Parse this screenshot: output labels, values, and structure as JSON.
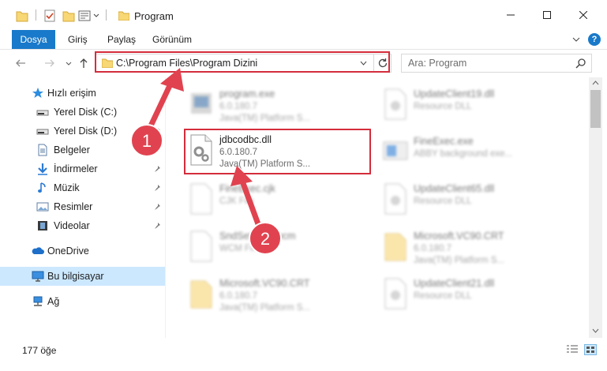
{
  "window": {
    "title": "Program"
  },
  "ribbon": {
    "tabs": [
      "Dosya",
      "Giriş",
      "Paylaş",
      "Görünüm"
    ]
  },
  "address": {
    "path": "C:\\Program Files\\Program Dizini"
  },
  "search": {
    "placeholder": "Ara: Program"
  },
  "sidebar": {
    "items": [
      {
        "label": "Hızlı erişim",
        "icon": "star-icon"
      },
      {
        "label": "Yerel Disk (C:)",
        "icon": "drive-icon",
        "pinned": true
      },
      {
        "label": "Yerel Disk (D:)",
        "icon": "drive-icon",
        "pinned": true
      },
      {
        "label": "Belgeler",
        "icon": "documents-icon",
        "pinned": true
      },
      {
        "label": "İndirmeler",
        "icon": "downloads-icon",
        "pinned": true
      },
      {
        "label": "Müzik",
        "icon": "music-icon",
        "pinned": true
      },
      {
        "label": "Resimler",
        "icon": "pictures-icon",
        "pinned": true
      },
      {
        "label": "Videolar",
        "icon": "videos-icon",
        "pinned": true
      },
      {
        "label": "OneDrive",
        "icon": "cloud-icon"
      },
      {
        "label": "Bu bilgisayar",
        "icon": "computer-icon",
        "selected": true
      },
      {
        "label": "Ağ",
        "icon": "network-icon"
      }
    ]
  },
  "files": [
    {
      "name": "program.exe",
      "line2": "6.0.180.7",
      "line3": "Java(TM) Platform S...",
      "icon": "exe-icon"
    },
    {
      "name": "UpdateClient19.dll",
      "line2": "Resource DLL",
      "line3": "",
      "icon": "dll-icon"
    },
    {
      "name": "jdbcodbc.dll",
      "line2": "6.0.180.7",
      "line3": "Java(TM) Platform S...",
      "icon": "dll-gear-icon",
      "highlighted": true
    },
    {
      "name": "FineExec.exe",
      "line2": "ABBY background exe...",
      "line3": "",
      "icon": "exe-icon"
    },
    {
      "name": "FineExec.cjk",
      "line2": "CJK File",
      "line3": "",
      "icon": "file-icon"
    },
    {
      "name": "UpdateClient65.dll",
      "line2": "Resource DLL",
      "line3": "",
      "icon": "dll-icon"
    },
    {
      "name": "SndSettings.wcm",
      "line2": "WCM File",
      "line3": "",
      "icon": "file-icon"
    },
    {
      "name": "Microsoft.VC90.CRT",
      "line2": "6.0.180.7",
      "line3": "Java(TM) Platform S...",
      "icon": "folder-icon"
    },
    {
      "name": "Microsoft.VC90.CRT",
      "line2": "6.0.180.7",
      "line3": "Java(TM) Platform S...",
      "icon": "folder-icon"
    },
    {
      "name": "UpdateClient21.dll",
      "line2": "Resource DLL",
      "line3": "",
      "icon": "dll-icon"
    }
  ],
  "status": {
    "item_count": "177 öğe"
  },
  "annotations": {
    "badge1": "1",
    "badge2": "2",
    "color": "#e0434f"
  },
  "colors": {
    "accent": "#1979ca",
    "selection": "#cce8ff",
    "highlight_box": "#d42d3c"
  }
}
